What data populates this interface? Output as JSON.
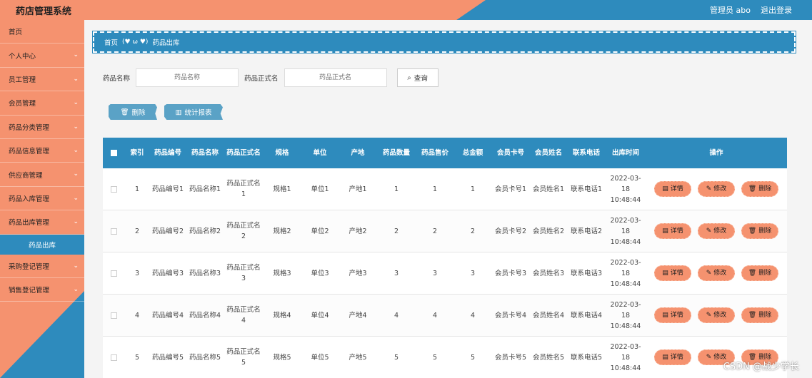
{
  "header": {
    "title": "药店管理系统",
    "user": "管理员 abo",
    "logout": "退出登录"
  },
  "sidebar": {
    "items": [
      {
        "label": "首页",
        "has_children": false
      },
      {
        "label": "个人中心",
        "has_children": true
      },
      {
        "label": "员工管理",
        "has_children": true
      },
      {
        "label": "会员管理",
        "has_children": true
      },
      {
        "label": "药品分类管理",
        "has_children": true
      },
      {
        "label": "药品信息管理",
        "has_children": true
      },
      {
        "label": "供应商管理",
        "has_children": true
      },
      {
        "label": "药品入库管理",
        "has_children": true
      },
      {
        "label": "药品出库管理",
        "has_children": true
      }
    ],
    "active_sub": "药品出库",
    "items_after": [
      {
        "label": "采购登记管理"
      },
      {
        "label": "销售登记管理"
      }
    ]
  },
  "breadcrumb": {
    "home": "首页",
    "emoji": "(♥ ω ♥)",
    "current": "药品出库"
  },
  "search": {
    "name_label": "药品名称",
    "name_placeholder": "药品名称",
    "fullname_label": "药品正式名",
    "fullname_placeholder": "药品正式名",
    "query_label": "查询"
  },
  "actions": {
    "delete": "删除",
    "stats": "统计报表"
  },
  "table": {
    "headers": [
      "索引",
      "药品编号",
      "药品名称",
      "药品正式名",
      "规格",
      "单位",
      "产地",
      "药品数量",
      "药品售价",
      "总金额",
      "会员卡号",
      "会员姓名",
      "联系电话",
      "出库时间",
      "操作"
    ],
    "ops": {
      "detail": "详情",
      "edit": "修改",
      "delete": "删除"
    },
    "rows": [
      {
        "idx": "1",
        "code": "药品编号1",
        "name": "药品名称1",
        "fname": "药品正式名1",
        "spec": "规格1",
        "unit": "单位1",
        "origin": "产地1",
        "qty": "1",
        "price": "1",
        "total": "1",
        "card": "会员卡号1",
        "mname": "会员姓名1",
        "phone": "联系电话1",
        "time": "2022-03-18 10:48:44"
      },
      {
        "idx": "2",
        "code": "药品编号2",
        "name": "药品名称2",
        "fname": "药品正式名2",
        "spec": "规格2",
        "unit": "单位2",
        "origin": "产地2",
        "qty": "2",
        "price": "2",
        "total": "2",
        "card": "会员卡号2",
        "mname": "会员姓名2",
        "phone": "联系电话2",
        "time": "2022-03-18 10:48:44"
      },
      {
        "idx": "3",
        "code": "药品编号3",
        "name": "药品名称3",
        "fname": "药品正式名3",
        "spec": "规格3",
        "unit": "单位3",
        "origin": "产地3",
        "qty": "3",
        "price": "3",
        "total": "3",
        "card": "会员卡号3",
        "mname": "会员姓名3",
        "phone": "联系电话3",
        "time": "2022-03-18 10:48:44"
      },
      {
        "idx": "4",
        "code": "药品编号4",
        "name": "药品名称4",
        "fname": "药品正式名4",
        "spec": "规格4",
        "unit": "单位4",
        "origin": "产地4",
        "qty": "4",
        "price": "4",
        "total": "4",
        "card": "会员卡号4",
        "mname": "会员姓名4",
        "phone": "联系电话4",
        "time": "2022-03-18 10:48:44"
      },
      {
        "idx": "5",
        "code": "药品编号5",
        "name": "药品名称5",
        "fname": "药品正式名5",
        "spec": "规格5",
        "unit": "单位5",
        "origin": "产地5",
        "qty": "5",
        "price": "5",
        "total": "5",
        "card": "会员卡号5",
        "mname": "会员姓名5",
        "phone": "联系电话5",
        "time": "2022-03-18 10:48:44"
      }
    ]
  },
  "watermark": "CSDN @战少学长",
  "colors": {
    "primary": "#2e8bbd",
    "accent": "#f5926f"
  }
}
